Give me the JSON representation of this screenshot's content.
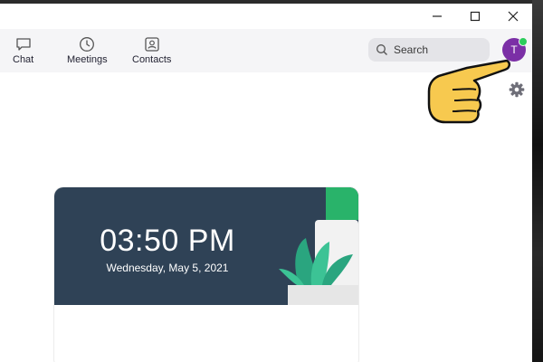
{
  "nav": {
    "chat_label": "Chat",
    "meetings_label": "Meetings",
    "contacts_label": "Contacts"
  },
  "search": {
    "placeholder": "Search"
  },
  "user": {
    "avatar_initial": "T",
    "avatar_color": "#7b2fa6",
    "status_color": "#2bcc5b"
  },
  "clock": {
    "time": "03:50 PM",
    "date": "Wednesday, May 5, 2021"
  },
  "icons": [
    "minimize-icon",
    "maximize-icon",
    "close-icon",
    "chat-icon",
    "clock-icon",
    "contacts-icon",
    "search-icon",
    "gear-icon",
    "plant-illustration",
    "pointing-hand-icon"
  ]
}
